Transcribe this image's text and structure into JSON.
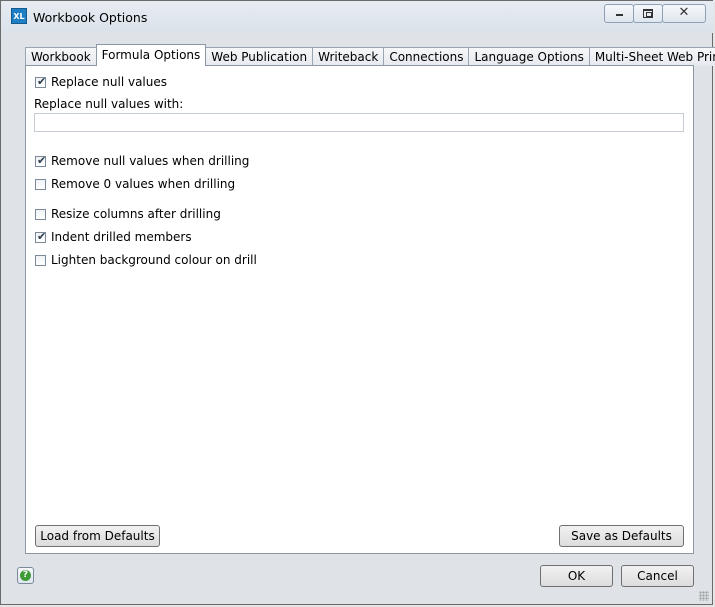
{
  "window": {
    "title": "Workbook Options",
    "app_icon_text": "XL"
  },
  "tabs": [
    {
      "label": "Workbook",
      "active": false
    },
    {
      "label": "Formula Options",
      "active": true
    },
    {
      "label": "Web Publication",
      "active": false
    },
    {
      "label": "Writeback",
      "active": false
    },
    {
      "label": "Connections",
      "active": false
    },
    {
      "label": "Language Options",
      "active": false
    },
    {
      "label": "Multi-Sheet Web Printing",
      "active": false
    }
  ],
  "options": {
    "replace_null": {
      "label": "Replace null values",
      "checked": true
    },
    "replace_with": {
      "label": "Replace null values with:",
      "value": ""
    },
    "remove_null_drill": {
      "label": "Remove null values when drilling",
      "checked": true
    },
    "remove_zero_drill": {
      "label": "Remove 0 values when drilling",
      "checked": false
    },
    "resize_columns": {
      "label": "Resize columns after drilling",
      "checked": false
    },
    "indent_members": {
      "label": "Indent drilled members",
      "checked": true
    },
    "lighten_background": {
      "label": "Lighten background colour on drill",
      "checked": false
    }
  },
  "buttons": {
    "load_defaults": "Load from Defaults",
    "save_defaults": "Save as Defaults",
    "ok": "OK",
    "cancel": "Cancel"
  },
  "window_controls": {
    "close_glyph": "✕"
  },
  "help_glyph": "?"
}
